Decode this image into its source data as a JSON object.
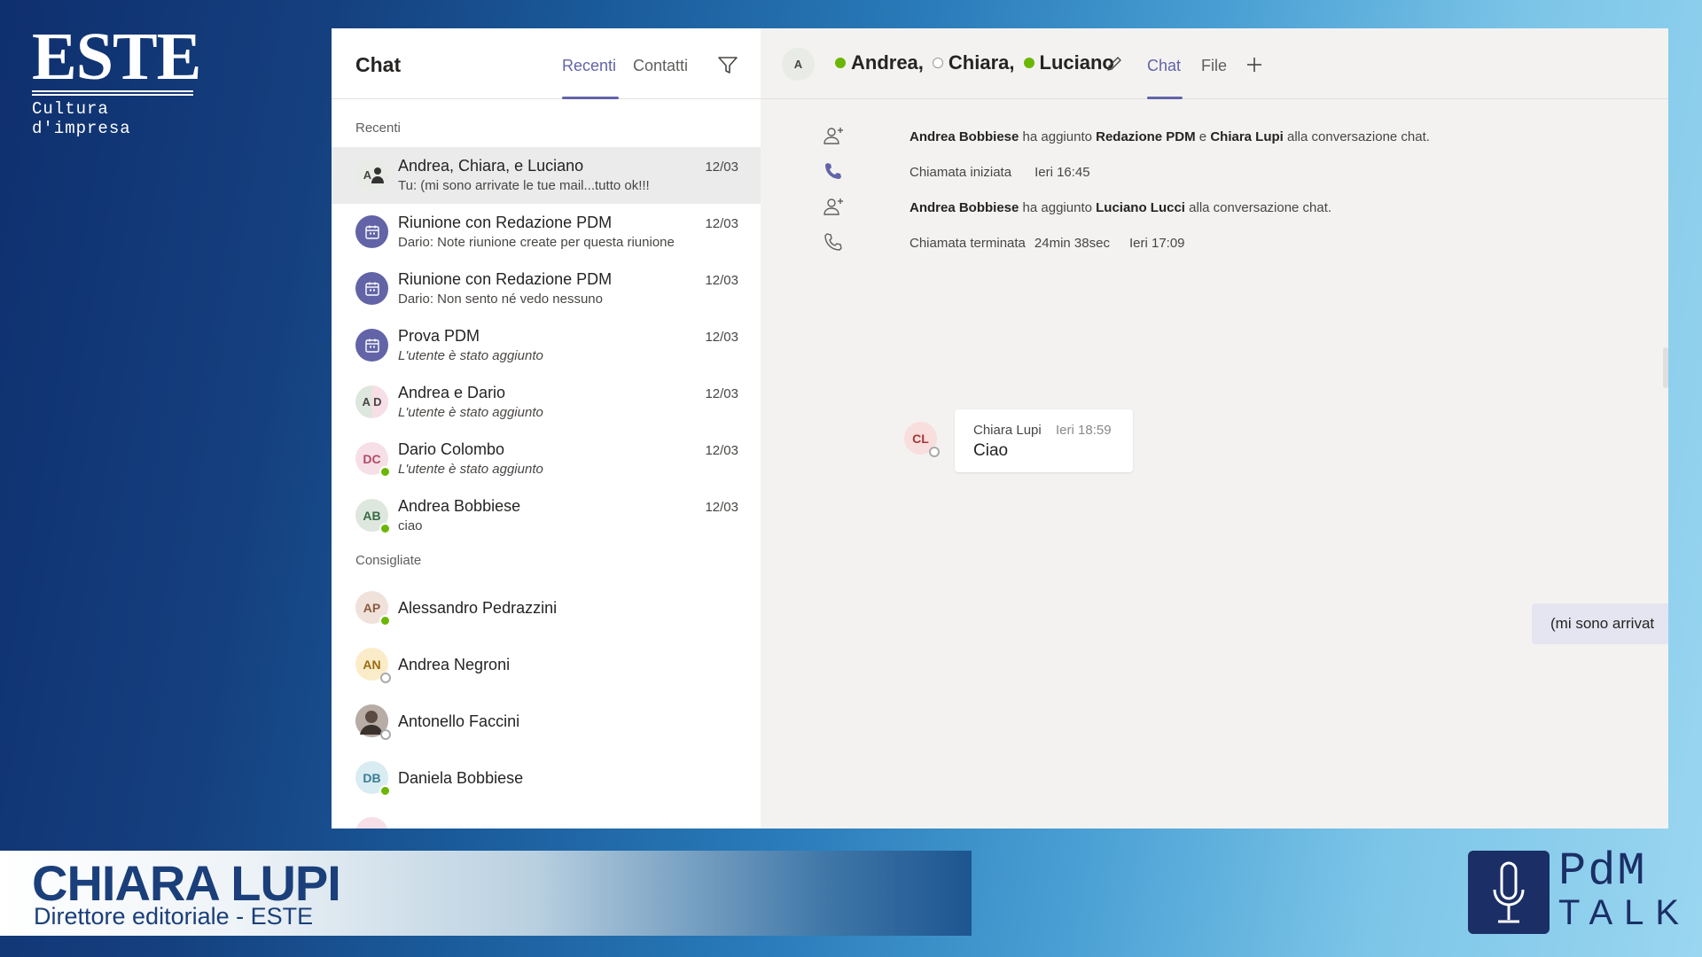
{
  "brand": {
    "logo_word": "ESTE",
    "logo_sub": "Cultura d'impresa"
  },
  "left_panel": {
    "title": "Chat",
    "tabs": [
      {
        "label": "Recenti",
        "active": true
      },
      {
        "label": "Contatti",
        "active": false
      }
    ],
    "section_recent": "Recenti",
    "section_suggested": "Consigliate",
    "recent_chats": [
      {
        "name": "Andrea, Chiara, e Luciano",
        "preview": "Tu: (mi sono arrivate le tue mail...tutto ok!!!",
        "date": "12/03",
        "avatar": "A",
        "selected": true
      },
      {
        "name": "Riunione con Redazione PDM",
        "preview": "Dario: Note riunione create per questa riunione",
        "date": "12/03",
        "avatar": "calendar-icon"
      },
      {
        "name": "Riunione con Redazione PDM",
        "preview": "Dario: Non sento né vedo nessuno",
        "date": "12/03",
        "avatar": "calendar-icon"
      },
      {
        "name": "Prova PDM",
        "preview": "L'utente è stato aggiunto",
        "date": "12/03",
        "avatar": "calendar-icon"
      },
      {
        "name": "Andrea e Dario",
        "preview": "L'utente è stato aggiunto",
        "date": "12/03",
        "avatar": "A D"
      },
      {
        "name": "Dario Colombo",
        "preview": "L'utente è stato aggiunto",
        "date": "12/03",
        "avatar": "DC"
      },
      {
        "name": "Andrea Bobbiese",
        "preview": "ciao",
        "date": "12/03",
        "avatar": "AB"
      }
    ],
    "suggested": [
      {
        "name": "Alessandro Pedrazzini",
        "avatar": "AP"
      },
      {
        "name": "Andrea Negroni",
        "avatar": "AN"
      },
      {
        "name": "Antonello Faccini",
        "avatar": "photo"
      },
      {
        "name": "Daniela Bobbiese",
        "avatar": "DB"
      }
    ]
  },
  "conversation": {
    "participants": [
      "Andrea,",
      "Chiara,",
      "Luciano"
    ],
    "tabs": [
      {
        "label": "Chat",
        "active": true
      },
      {
        "label": "File",
        "active": false
      }
    ],
    "events": [
      {
        "actor": "Andrea Bobbiese",
        "text1": " ha aggiunto ",
        "target1": "Redazione PDM",
        "text2": " e ",
        "target2": "Chiara Lupi",
        "text3": " alla conversazione chat."
      },
      {
        "label": "Chiamata iniziata",
        "time": "Ieri 16:45"
      },
      {
        "actor": "Andrea Bobbiese",
        "text1": " ha aggiunto ",
        "target1": "Luciano Lucci",
        "text3": " alla conversazione chat."
      },
      {
        "label": "Chiamata terminata",
        "duration": "24min 38sec",
        "time": "Ieri 17:09"
      }
    ],
    "message": {
      "avatar": "CL",
      "author": "Chiara Lupi",
      "time": "Ieri 18:59",
      "text": "Ciao"
    },
    "own_message": "(mi sono arrivat"
  },
  "lower_third": {
    "name": "CHIARA LUPI",
    "role": "Direttore editoriale - ESTE"
  },
  "pdm_logo": {
    "line1": "PdM",
    "line2": "TALK"
  },
  "colors": {
    "accent": "#6264a7",
    "online": "#6bb700",
    "brand_blue": "#1b2f66"
  }
}
